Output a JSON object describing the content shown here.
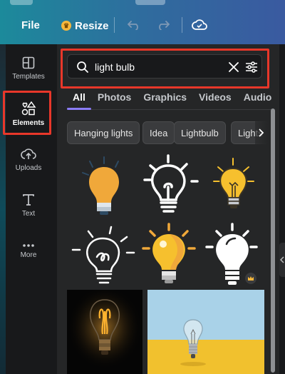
{
  "topbar": {
    "file_label": "File",
    "resize_label": "Resize",
    "icons": [
      "crown-icon",
      "undo-icon",
      "redo-icon",
      "cloud-sync-icon"
    ]
  },
  "rail": {
    "items": [
      {
        "label": "Templates",
        "icon": "templates-icon"
      },
      {
        "label": "Elements",
        "icon": "elements-icon",
        "active": true
      },
      {
        "label": "Uploads",
        "icon": "upload-icon"
      },
      {
        "label": "Text",
        "icon": "text-icon"
      },
      {
        "label": "More",
        "icon": "more-icon"
      }
    ]
  },
  "search": {
    "value": "light bulb",
    "icons": [
      "search-icon",
      "clear-icon",
      "filter-icon"
    ]
  },
  "tabs": [
    "All",
    "Photos",
    "Graphics",
    "Videos",
    "Audio"
  ],
  "chips": [
    "Hanging lights",
    "Idea",
    "Lightbulb",
    "Lights"
  ],
  "colors": {
    "highlight": "#e8372a",
    "tab_active": "#8b7cf6",
    "bulb_yellow": "#f6c02e",
    "bulb_orange": "#f0a83a",
    "photo_blue": "#a9d2e8",
    "photo_yellow": "#f1c12e"
  }
}
